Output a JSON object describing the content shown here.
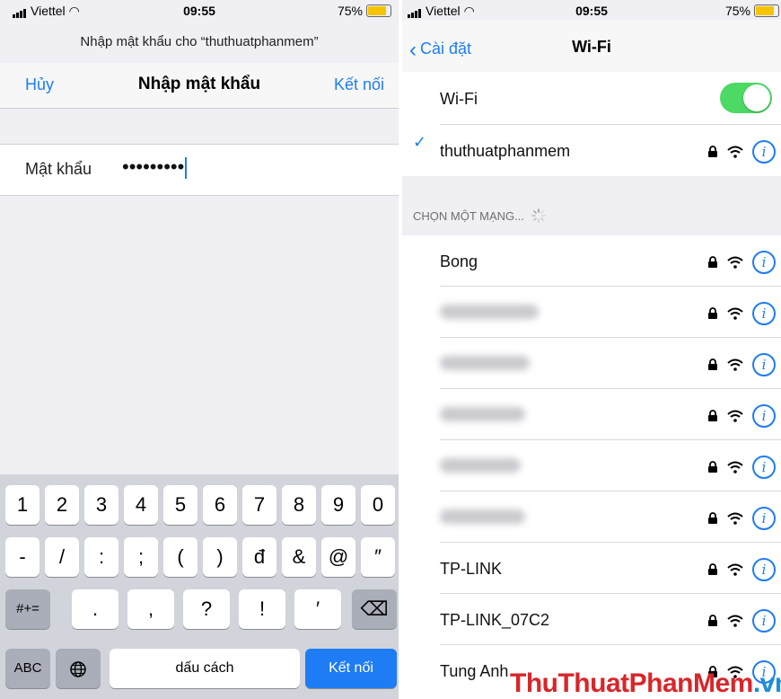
{
  "left": {
    "status": {
      "carrier": "Viettel",
      "time": "09:55",
      "battery": "75%"
    },
    "prompt": "Nhập mật khẩu cho “thuthuatphanmem”",
    "nav": {
      "cancel": "Hủy",
      "title": "Nhập mật khẩu",
      "connect": "Kết nối"
    },
    "password": {
      "label": "Mật khẩu",
      "value": "•••••••••"
    },
    "keyboard": {
      "row1": [
        "1",
        "2",
        "3",
        "4",
        "5",
        "6",
        "7",
        "8",
        "9",
        "0"
      ],
      "row2": [
        "-",
        "/",
        ":",
        ";",
        "(",
        ")",
        "đ",
        "&",
        "@",
        "″"
      ],
      "row3_left": "#+=",
      "row3": [
        ".",
        ",",
        "?",
        "!",
        "′"
      ],
      "backspace": "⌫",
      "abc": "ABC",
      "globe": "globe-icon",
      "space": "dấu cách",
      "return": "Kết nối"
    }
  },
  "right": {
    "status": {
      "carrier": "Viettel",
      "time": "09:55",
      "battery": "75%"
    },
    "nav": {
      "back": "Cài đặt",
      "title": "Wi-Fi"
    },
    "wifi": {
      "label": "Wi-Fi",
      "enabled": true,
      "connected": "thuthuatphanmem"
    },
    "section_header": "CHỌN MỘT MẠNG...",
    "networks": [
      {
        "name": "Bong",
        "blurred": false
      },
      {
        "name": "",
        "blurred": true
      },
      {
        "name": "",
        "blurred": true
      },
      {
        "name": "",
        "blurred": true
      },
      {
        "name": "",
        "blurred": true
      },
      {
        "name": "",
        "blurred": true
      },
      {
        "name": "TP-LINK",
        "blurred": false
      },
      {
        "name": "TP-LINK_07C2",
        "blurred": false
      },
      {
        "name": "Tung Anh",
        "blurred": false
      }
    ],
    "accent": "#1e7cf5",
    "toggle_color": "#4cd964"
  },
  "watermark": {
    "part1": "ThuThuatPhanMem",
    "part2": ".vn"
  }
}
